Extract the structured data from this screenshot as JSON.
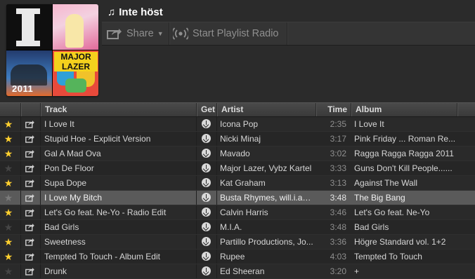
{
  "playlist": {
    "title": "Inte höst",
    "cover_texts": {
      "topleft_letter": "I",
      "bottomleft_year": "2011",
      "bottomright_brand": "MAJOR LAZER"
    }
  },
  "toolbar": {
    "share_label": "Share",
    "radio_label": "Start Playlist Radio"
  },
  "columns": {
    "track": "Track",
    "get": "Get",
    "artist": "Artist",
    "time": "Time",
    "album": "Album"
  },
  "tracks": [
    {
      "starred": true,
      "track": "I Love It",
      "artist": "Icona Pop",
      "time": "2:35",
      "album": "I Love It"
    },
    {
      "starred": true,
      "track": "Stupid Hoe - Explicit Version",
      "artist": "Nicki Minaj",
      "time": "3:17",
      "album": "Pink Friday ... Roman Re..."
    },
    {
      "starred": true,
      "track": "Gal A Mad Ova",
      "artist": "Mavado",
      "time": "3:02",
      "album": "Ragga Ragga Ragga 2011"
    },
    {
      "starred": false,
      "track": "Pon De Floor",
      "artist": "Major Lazer, Vybz Kartel",
      "time": "3:33",
      "album": "Guns Don't Kill People......"
    },
    {
      "starred": true,
      "track": "Supa Dope",
      "artist": "Kat Graham",
      "time": "3:13",
      "album": "Against The Wall"
    },
    {
      "starred": false,
      "track": "I Love My Bitch",
      "artist": "Busta Rhymes, will.i.am, ...",
      "time": "3:48",
      "album": "The Big Bang",
      "selected": true
    },
    {
      "starred": true,
      "track": "Let's Go feat. Ne-Yo - Radio Edit",
      "artist": "Calvin Harris",
      "time": "3:46",
      "album": "Let's Go feat. Ne-Yo"
    },
    {
      "starred": false,
      "track": "Bad Girls",
      "artist": "M.I.A.",
      "time": "3:48",
      "album": "Bad Girls"
    },
    {
      "starred": true,
      "track": "Sweetness",
      "artist": "Partillo Productions, Jo...",
      "time": "3:36",
      "album": "Högre Standard vol. 1+2"
    },
    {
      "starred": true,
      "track": "Tempted To Touch - Album Edit",
      "artist": "Rupee",
      "time": "4:03",
      "album": "Tempted To Touch"
    },
    {
      "starred": false,
      "track": "Drunk",
      "artist": "Ed Sheeran",
      "time": "3:20",
      "album": "+"
    }
  ],
  "icons": {
    "star": "star-icon",
    "share": "share-icon",
    "get": "download-icon",
    "radio": "radio-icon",
    "note": "music-note-icon"
  },
  "colors": {
    "star_on": "#ffd02f",
    "star_off": "#454545",
    "selected_row": "#5a5a5a"
  }
}
